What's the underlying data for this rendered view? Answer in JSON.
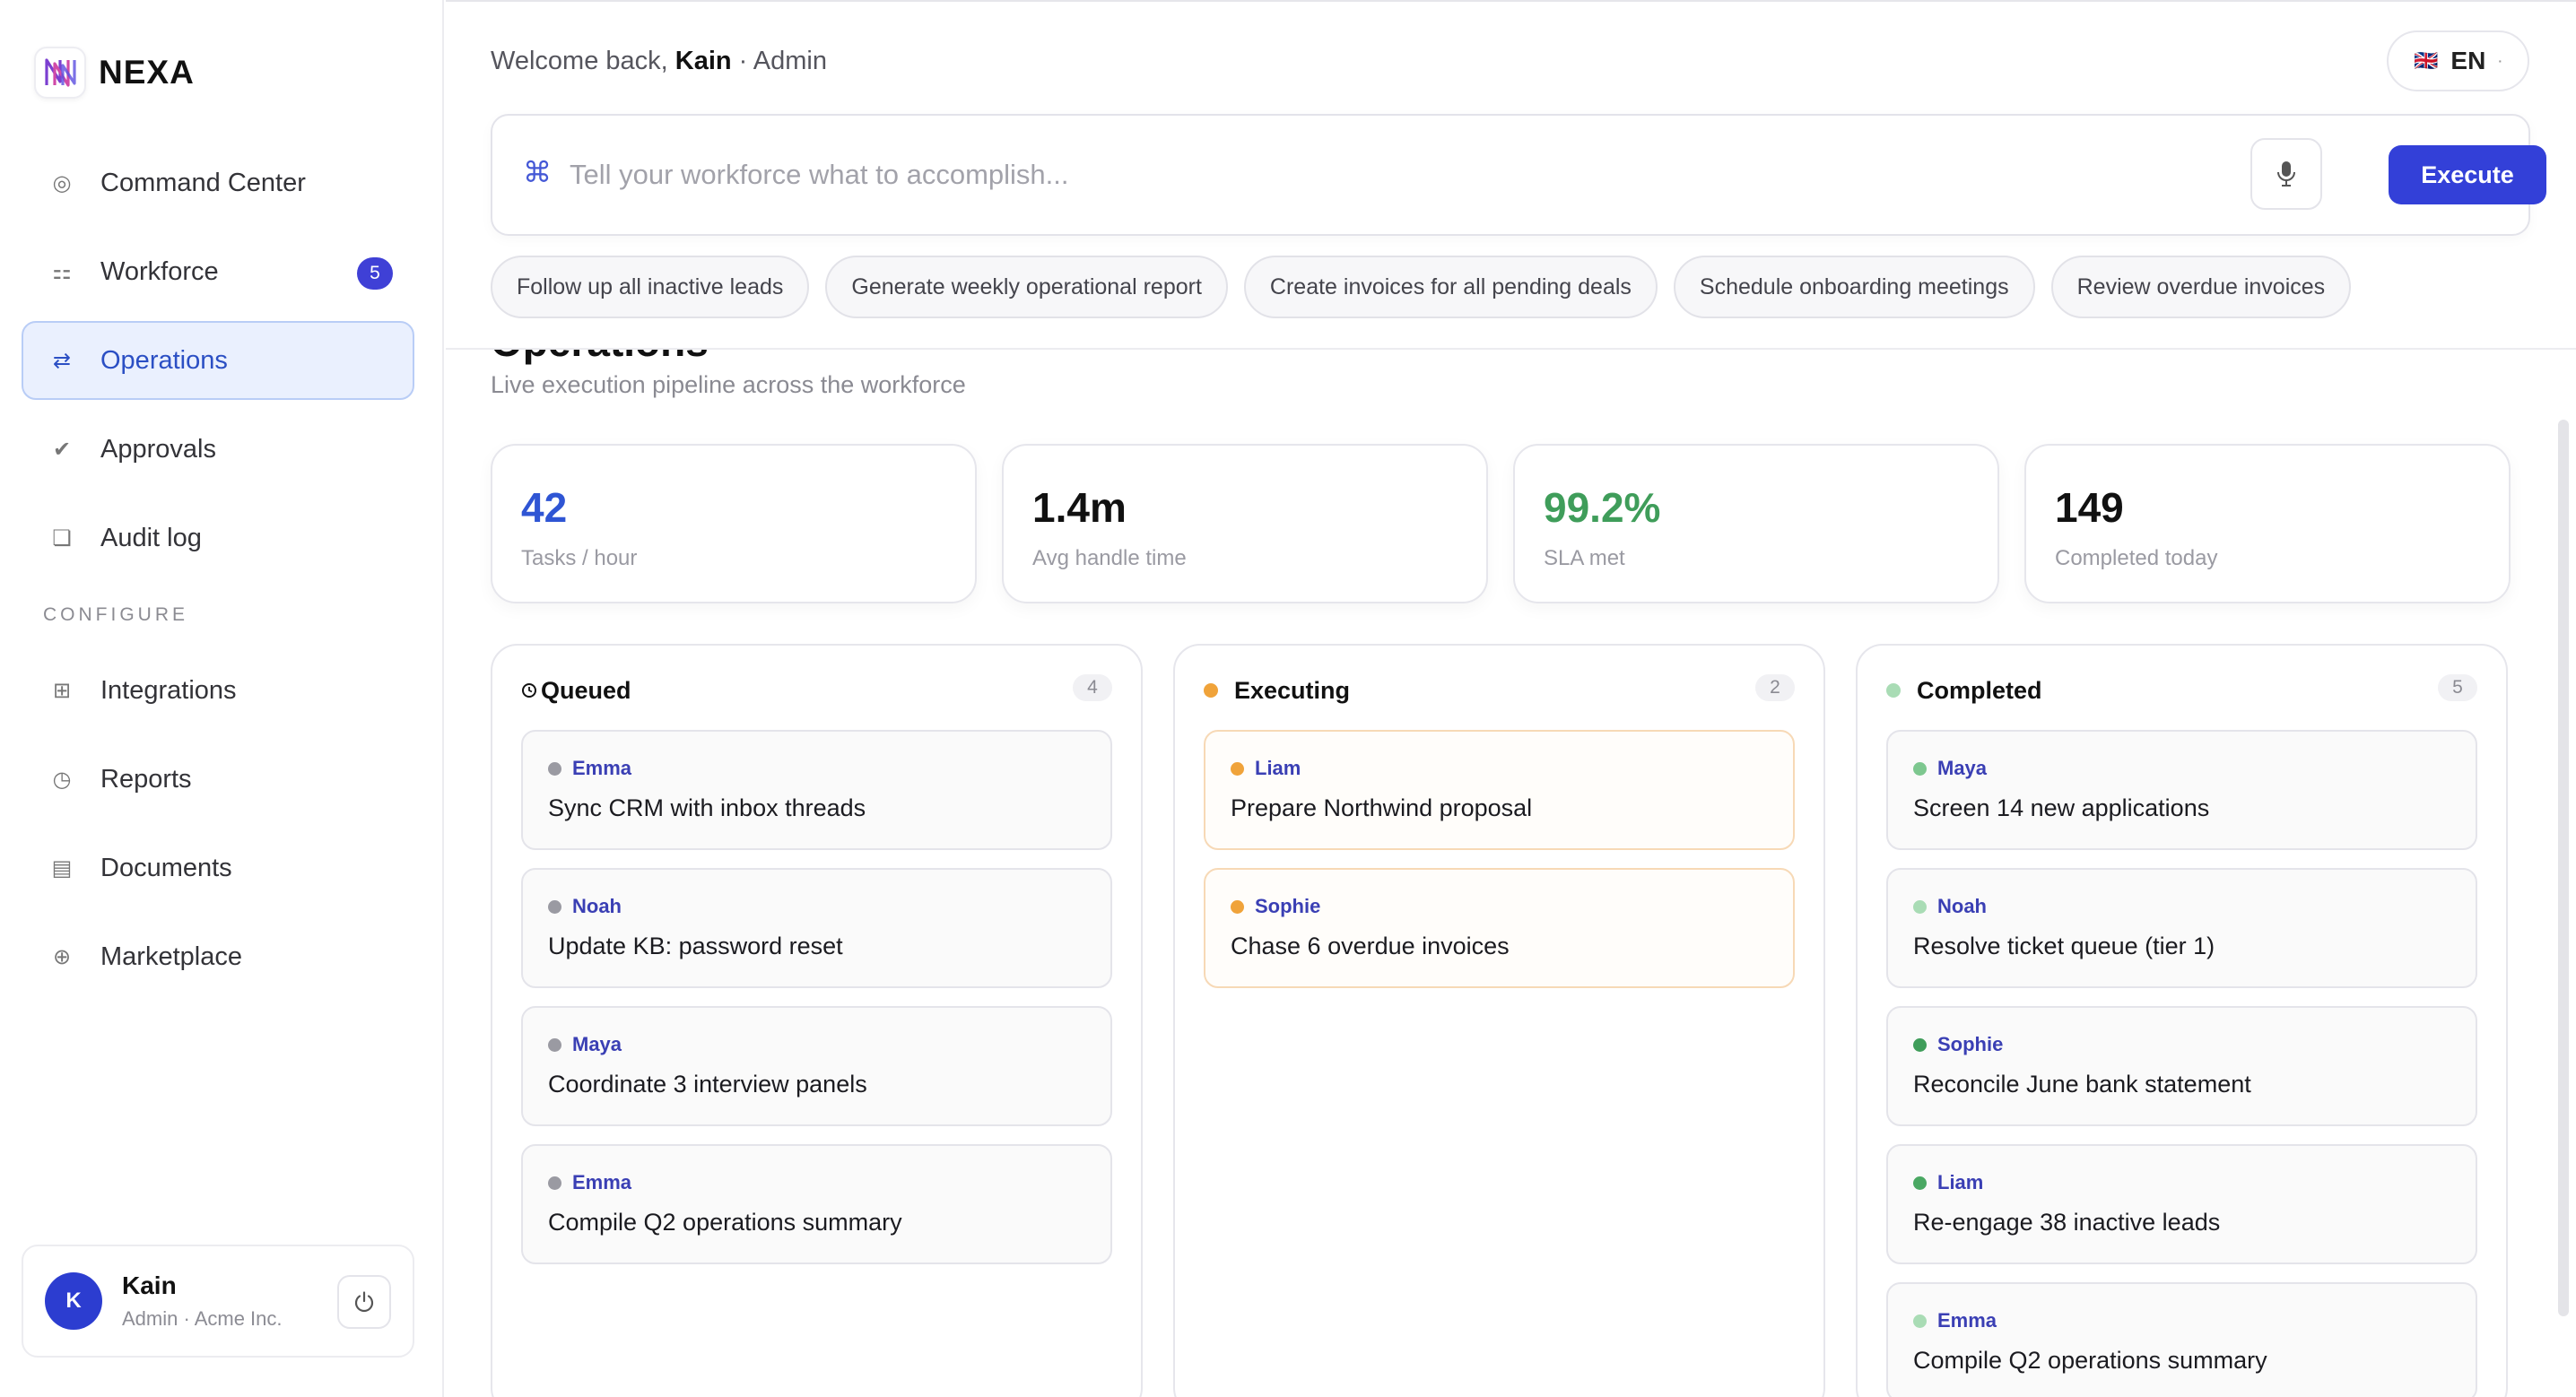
{
  "brand": {
    "name": "NEXA"
  },
  "nav": {
    "items": [
      {
        "label": "Command Center",
        "icon": "radar-icon",
        "glyph": "◎",
        "badge": ""
      },
      {
        "label": "Workforce",
        "icon": "team-icon",
        "glyph": "⚏",
        "badge": "5"
      },
      {
        "label": "Operations",
        "icon": "swap-arrows-icon",
        "glyph": "⇄",
        "badge": "",
        "active": true
      },
      {
        "label": "Approvals",
        "icon": "check-icon",
        "glyph": "✔",
        "badge": ""
      },
      {
        "label": "Audit log",
        "icon": "log-icon",
        "glyph": "❏",
        "badge": ""
      }
    ],
    "section_label": "CONFIGURE",
    "config_items": [
      {
        "label": "Integrations",
        "icon": "grid-icon",
        "glyph": "⊞"
      },
      {
        "label": "Reports",
        "icon": "clock-icon",
        "glyph": "◷"
      },
      {
        "label": "Documents",
        "icon": "document-icon",
        "glyph": "▤"
      },
      {
        "label": "Marketplace",
        "icon": "plus-circle-icon",
        "glyph": "⊕"
      }
    ]
  },
  "user": {
    "initial": "K",
    "name": "Kain",
    "subtitle": "Admin · Acme Inc."
  },
  "header": {
    "welcome_prefix": "Welcome back, ",
    "welcome_name": "Kain",
    "welcome_role": " · Admin",
    "language": {
      "flag": "🇬🇧",
      "code": "EN",
      "caret": "·"
    }
  },
  "command": {
    "icon": "⌘",
    "placeholder": "Tell your workforce what to accomplish...",
    "execute_label": "Execute"
  },
  "suggestions": [
    "Follow up all inactive leads",
    "Generate weekly operational report",
    "Create invoices for all pending deals",
    "Schedule onboarding meetings",
    "Review overdue invoices"
  ],
  "page": {
    "title": "Operations",
    "subtitle": "Live execution pipeline across the workforce"
  },
  "stats": [
    {
      "value": "42",
      "label": "Tasks / hour",
      "color": "#2f55d4"
    },
    {
      "value": "1.4m",
      "label": "Avg handle time",
      "color": "#111111"
    },
    {
      "value": "99.2%",
      "label": "SLA met",
      "color": "#3f9d5a"
    },
    {
      "value": "149",
      "label": "Completed today",
      "color": "#111111"
    }
  ],
  "columns": [
    {
      "title": "Queued",
      "count": "4",
      "kind": "queued",
      "dot_color": "",
      "cards": [
        {
          "agent": "Emma",
          "task": "Sync CRM with inbox threads",
          "dot_color": "#9a9aa2"
        },
        {
          "agent": "Noah",
          "task": "Update KB: password reset",
          "dot_color": "#9a9aa2"
        },
        {
          "agent": "Maya",
          "task": "Coordinate 3 interview panels",
          "dot_color": "#9a9aa2"
        },
        {
          "agent": "Emma",
          "task": "Compile Q2 operations summary",
          "dot_color": "#9a9aa2"
        }
      ]
    },
    {
      "title": "Executing",
      "count": "2",
      "kind": "executing",
      "dot_color": "#f0a33a",
      "cards": [
        {
          "agent": "Liam",
          "task": "Prepare Northwind proposal",
          "dot_color": "#f0a33a"
        },
        {
          "agent": "Sophie",
          "task": "Chase 6 overdue invoices",
          "dot_color": "#f0a33a"
        }
      ]
    },
    {
      "title": "Completed",
      "count": "5",
      "kind": "completed",
      "dot_color": "#a9dcb5",
      "cards": [
        {
          "agent": "Maya",
          "task": "Screen 14 new applications",
          "dot_color": "#7dc78f"
        },
        {
          "agent": "Noah",
          "task": "Resolve ticket queue (tier 1)",
          "dot_color": "#a9dcb5"
        },
        {
          "agent": "Sophie",
          "task": "Reconcile June bank statement",
          "dot_color": "#3f9d5a"
        },
        {
          "agent": "Liam",
          "task": "Re-engage 38 inactive leads",
          "dot_color": "#4aa863"
        },
        {
          "agent": "Emma",
          "task": "Compile Q2 operations summary",
          "dot_color": "#a9dcb5"
        }
      ]
    }
  ]
}
